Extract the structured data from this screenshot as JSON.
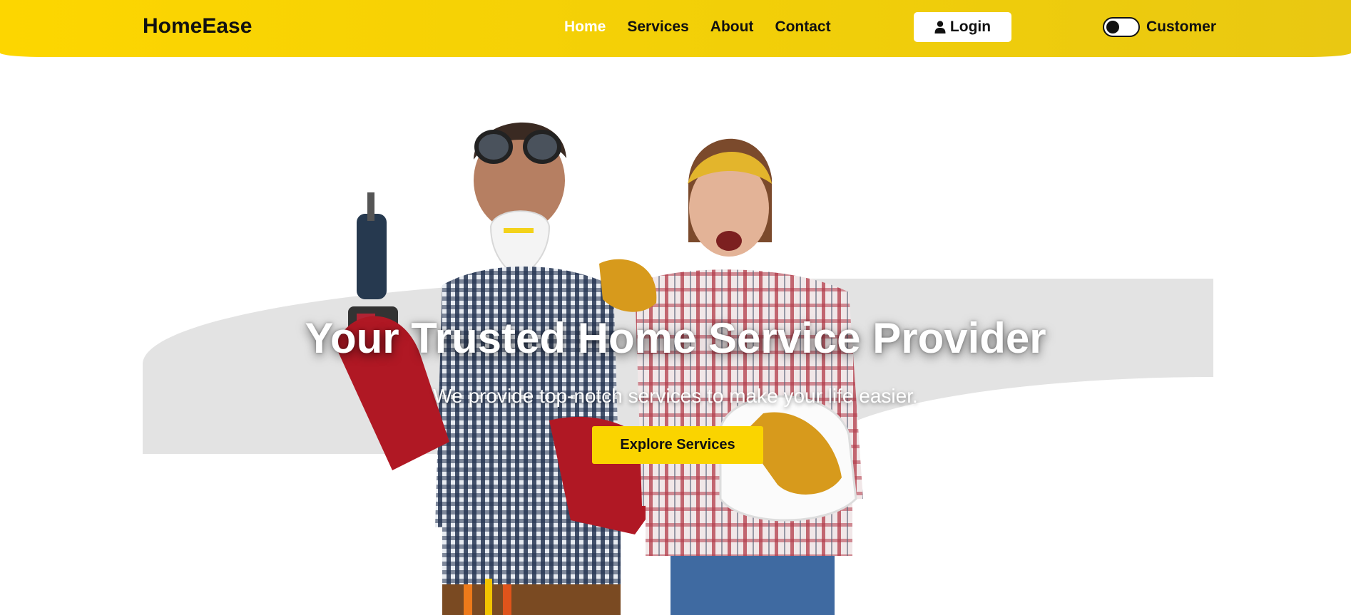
{
  "header": {
    "brand": "HomeEase",
    "nav": [
      {
        "label": "Home",
        "active": true
      },
      {
        "label": "Services",
        "active": false
      },
      {
        "label": "About",
        "active": false
      },
      {
        "label": "Contact",
        "active": false
      }
    ],
    "login_label": "Login",
    "login_icon": "user-icon",
    "mode_toggle_on": false,
    "mode_label": "Customer"
  },
  "hero": {
    "title": "Your Trusted Home Service Provider",
    "subtitle": "We provide top-notch services to make your life easier.",
    "cta_label": "Explore Services",
    "image": "two-workers-photo"
  },
  "colors": {
    "accent": "#fad400",
    "header_gradient_start": "#fdd600",
    "header_gradient_end": "#e9c812",
    "hero_shape": "#e3e3e3",
    "text": "#111111"
  }
}
